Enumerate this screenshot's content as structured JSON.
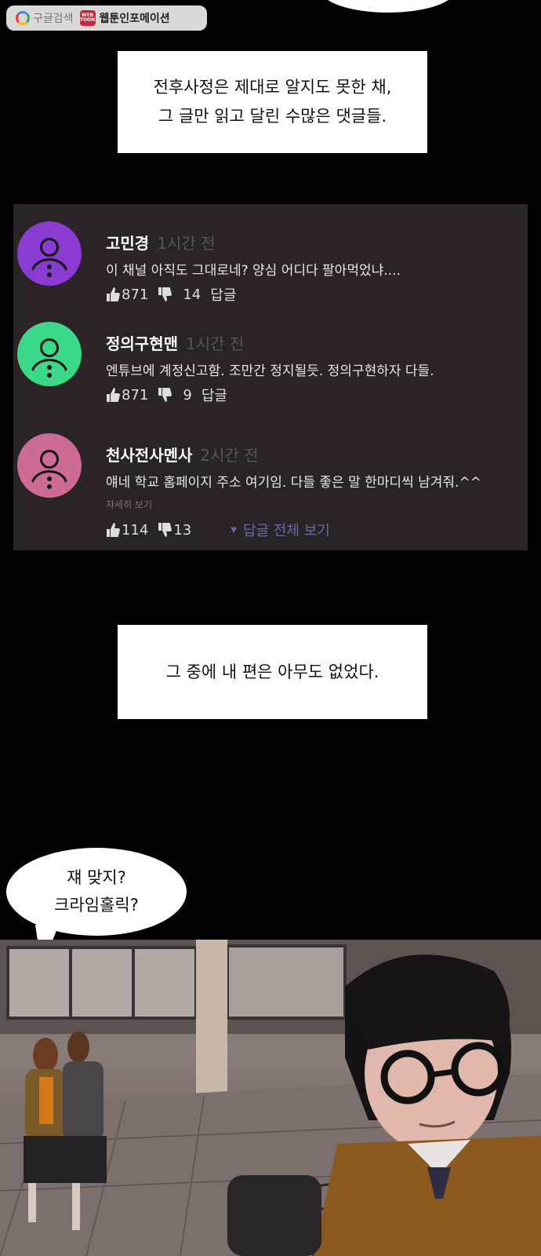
{
  "watermark": {
    "search_label": "구글검색",
    "webtoon_badge": "WEB TOON",
    "site_name": "웹툰인포메이션"
  },
  "caption_top": {
    "line1": "전후사정은 제대로 알지도 못한 채,",
    "line2": "그 글만 읽고 달린 수많은 댓글들."
  },
  "comments": [
    {
      "author": "고민경",
      "time": "1시간 전",
      "text": "이 채널 아직도 그대로네? 양심 어디다 팔아먹었냐....",
      "likes": "871",
      "dislikes": "14",
      "reply_label": "답글",
      "avatar_color": "#8a3bd1"
    },
    {
      "author": "정의구현맨",
      "time": "1시간 전",
      "text": "엔튜브에 계정신고함. 조만간 정지될듯. 정의구현하자 다들.",
      "likes": "871",
      "dislikes": "9",
      "reply_label": "답글",
      "avatar_color": "#3ad98a"
    },
    {
      "author": "천사전사멘사",
      "time": "2시간 전",
      "text": "얘네 학교 홈페이지 주소 여기임. 다들 좋은 말 한마디씩 남겨줘.^^",
      "more_label": "자세히 보기",
      "likes": "114",
      "dislikes": "13",
      "view_all_replies": "답글 전체 보기",
      "avatar_color": "#cc6b95"
    }
  ],
  "caption_middle": {
    "line1": "그 중에 내 편은 아무도 없었다."
  },
  "speech_bubble": {
    "line1": "쟤 맞지?",
    "line2": "크라임홀릭?"
  }
}
